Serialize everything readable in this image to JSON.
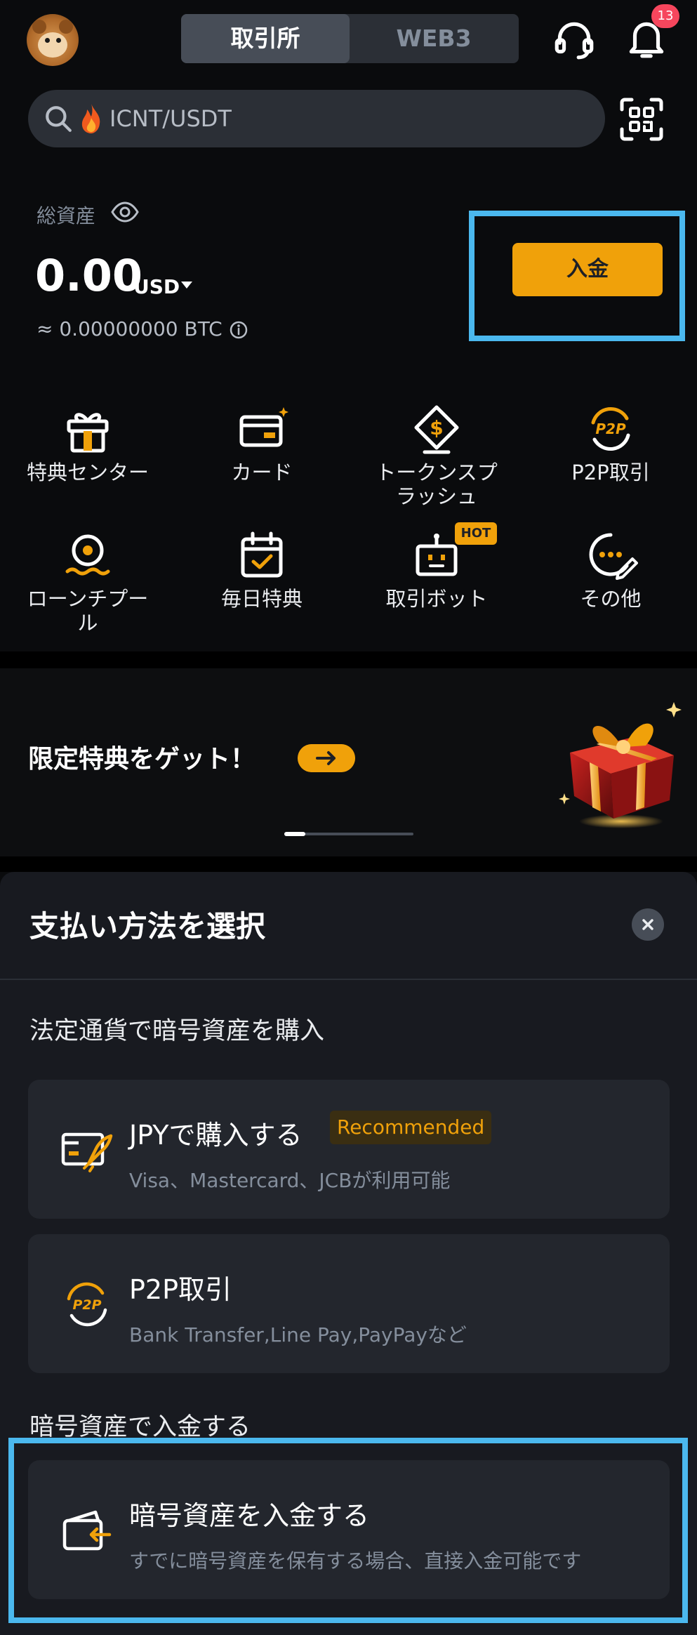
{
  "header": {
    "tabs": [
      {
        "label": "取引所",
        "active": true
      },
      {
        "label": "WEB3",
        "active": false
      }
    ],
    "notification_count": "13"
  },
  "search": {
    "placeholder": "ICNT/USDT"
  },
  "assets": {
    "label": "総資産",
    "balance": "0.00",
    "currency": "USD",
    "btc_equivalent": "≈ 0.00000000 BTC",
    "deposit_label": "入金"
  },
  "shortcuts": [
    {
      "label": "特典センター",
      "icon": "gift-icon"
    },
    {
      "label": "カード",
      "icon": "card-icon"
    },
    {
      "label": "トークンスプ\nラッシュ",
      "icon": "token-splash-icon"
    },
    {
      "label": "P2P取引",
      "icon": "p2p-icon"
    },
    {
      "label": "ローンチプー\nル",
      "icon": "launchpool-icon"
    },
    {
      "label": "毎日特典",
      "icon": "calendar-icon"
    },
    {
      "label": "取引ボット",
      "icon": "bot-icon",
      "badge": "HOT"
    },
    {
      "label": "その他",
      "icon": "more-icon"
    }
  ],
  "banner": {
    "text": "限定特典をゲット！"
  },
  "sheet": {
    "title": "支払い方法を選択",
    "section_fiat": "法定通貨で暗号資産を購入",
    "section_crypto": "暗号資産で入金する",
    "options": [
      {
        "title": "JPYで購入する",
        "badge": "Recommended",
        "subtitle": "Visa、Mastercard、JCBが利用可能"
      },
      {
        "title": "P2P取引",
        "subtitle": "Bank Transfer,Line Pay,PayPayなど"
      },
      {
        "title": "暗号資産を入金する",
        "subtitle": "すでに暗号資産を保有する場合、直接入金可能です"
      }
    ]
  },
  "colors": {
    "accent": "#f0a10a",
    "highlight": "#4bb8ee",
    "background": "#0a0b0d",
    "sheet": "#181a20"
  }
}
